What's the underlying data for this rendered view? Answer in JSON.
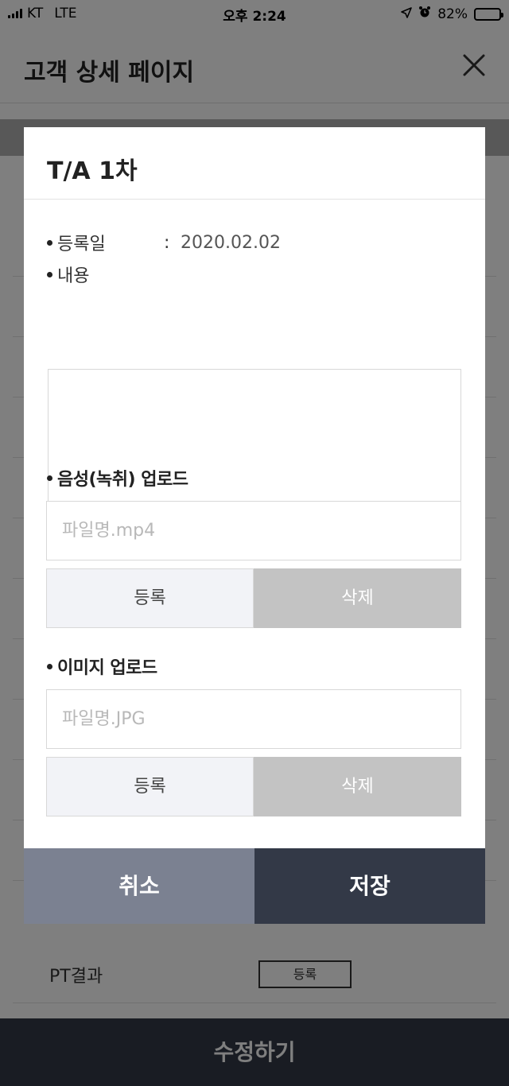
{
  "status_bar": {
    "carrier": "KT",
    "network": "LTE",
    "time": "오후 2:24",
    "battery": "82%",
    "battery_level": 0.82
  },
  "page": {
    "title": "고객 상세 페이지",
    "rows": [
      {
        "label": "PT결과",
        "button": "등록"
      }
    ],
    "bottom_button": "수정하기"
  },
  "modal": {
    "title": "T/A 1차",
    "registered_label": "등록일",
    "registered_separator": ":",
    "registered_date": "2020.02.02",
    "content_label": "내용",
    "content_value": "",
    "audio": {
      "title": "음성(녹취) 업로드",
      "placeholder": "파일명.mp4",
      "register_label": "등록",
      "delete_label": "삭제"
    },
    "image": {
      "title": "이미지 업로드",
      "placeholder": "파일명.JPG",
      "register_label": "등록",
      "delete_label": "삭제"
    },
    "cancel_label": "취소",
    "save_label": "저장"
  }
}
